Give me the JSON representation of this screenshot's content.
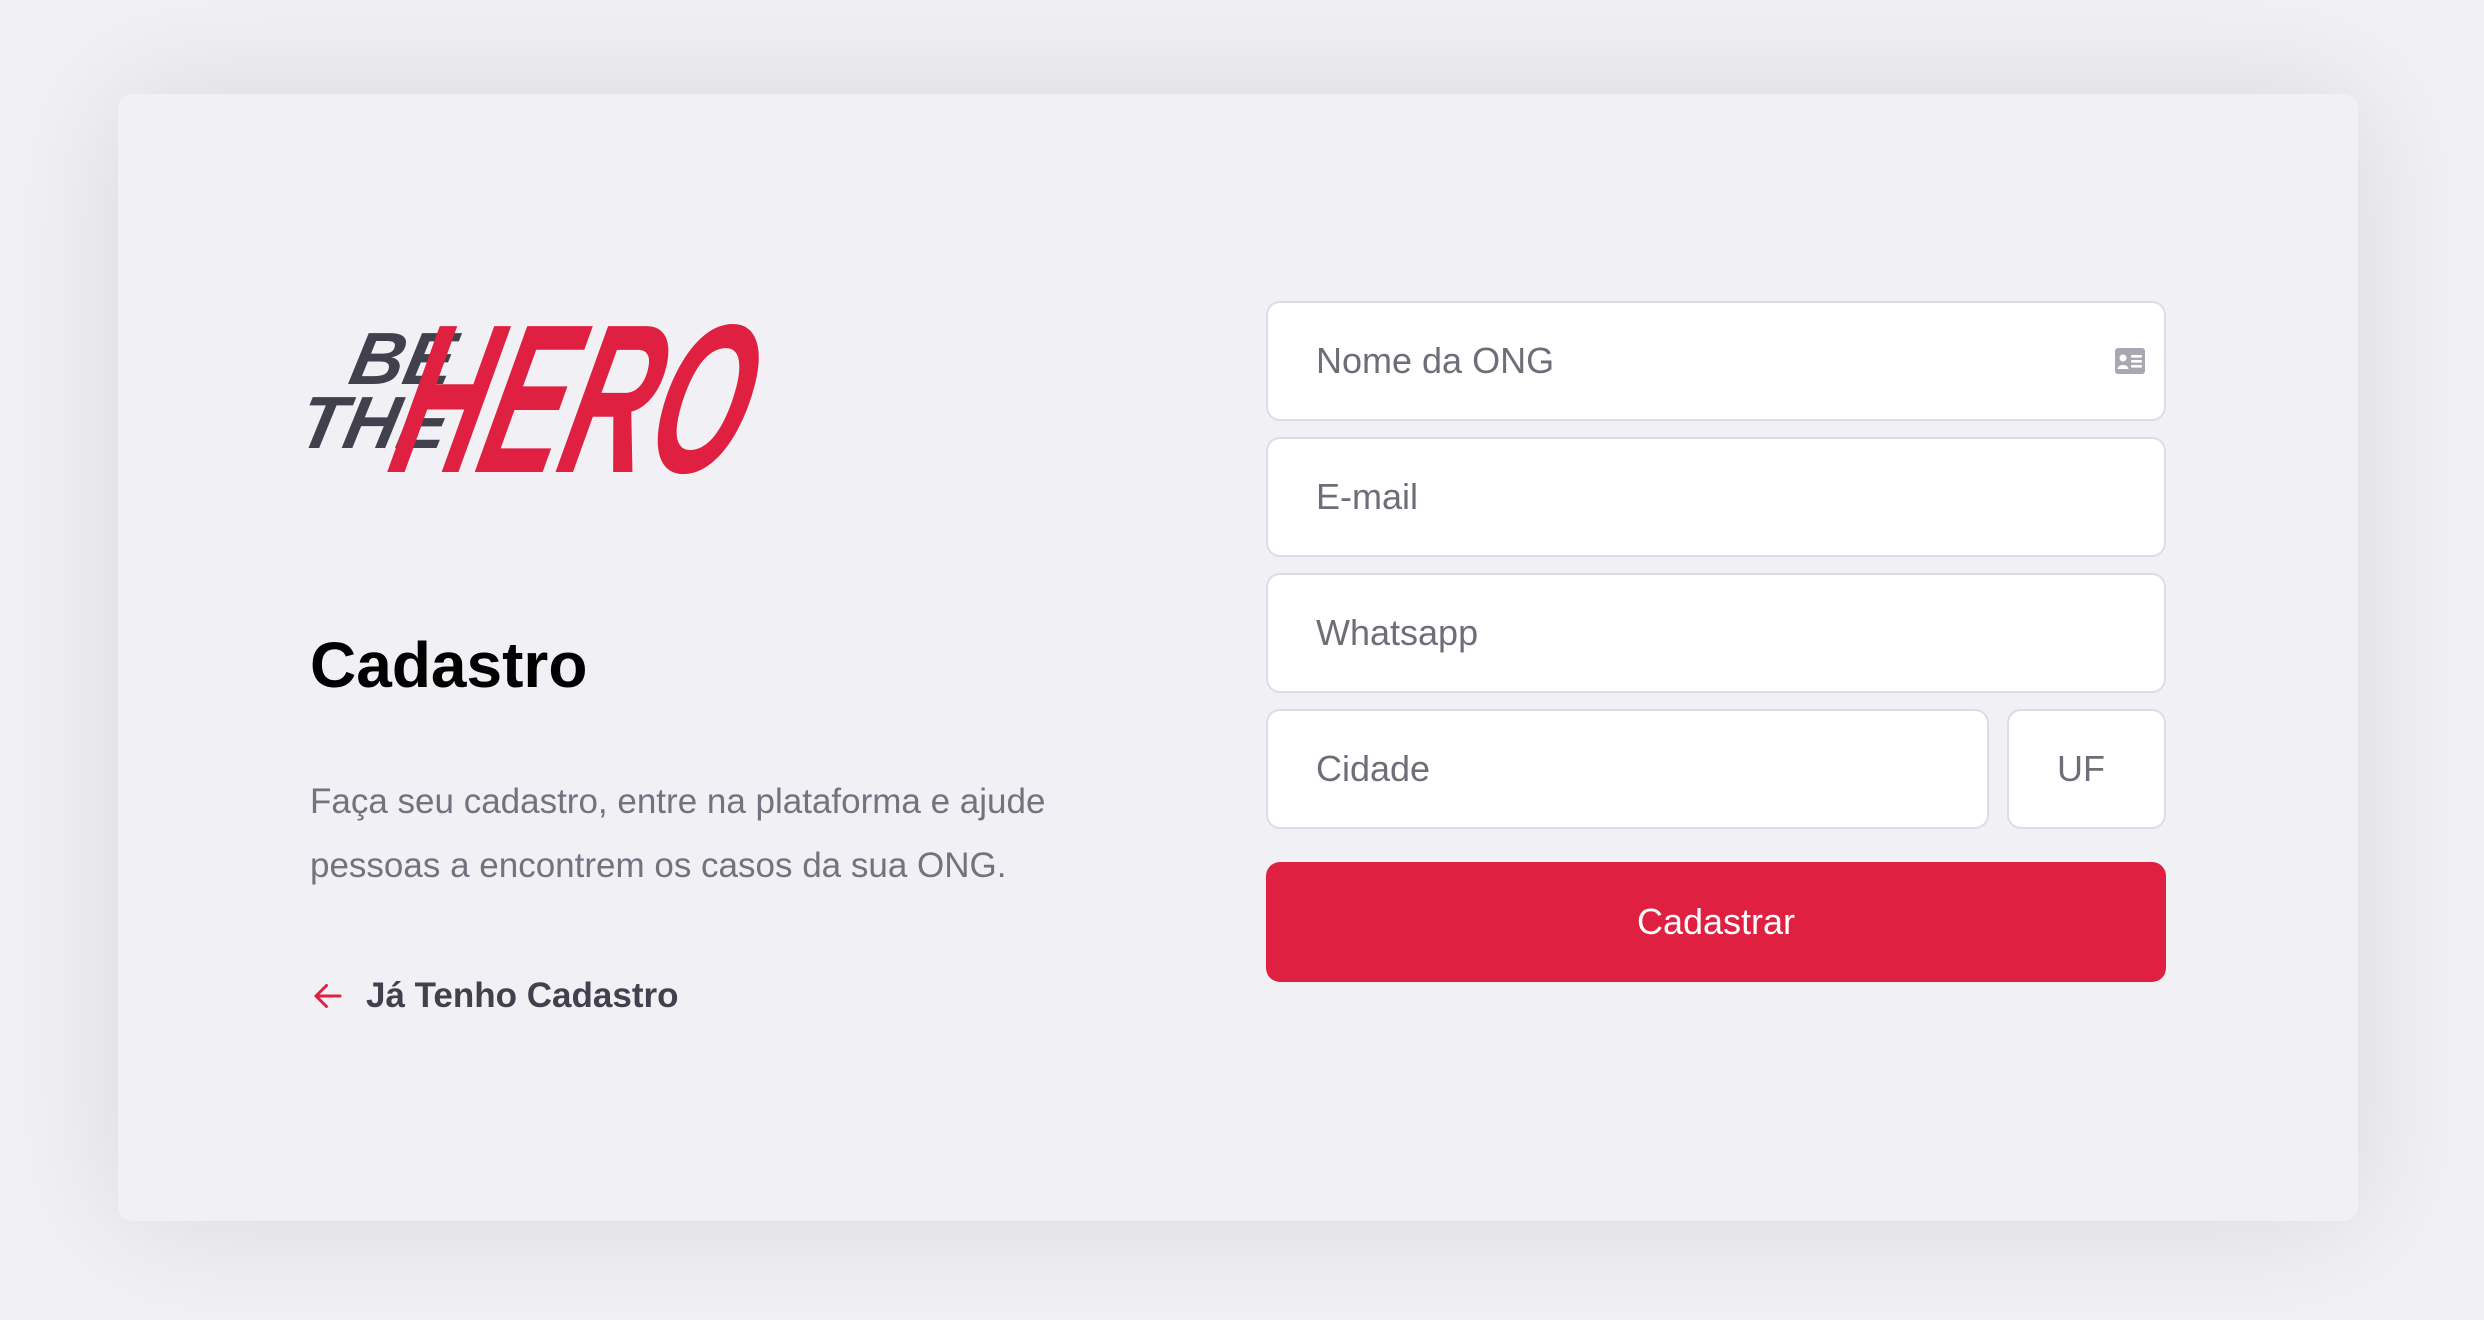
{
  "brand": {
    "logo_text_small_top": "BE",
    "logo_text_small_bottom": "THE",
    "logo_text_large": "HERO",
    "primary_color": "#e02041",
    "secondary_color": "#41414d"
  },
  "page": {
    "title": "Cadastro",
    "description": "Faça seu cadastro, entre na plataforma e ajude pessoas a encontrem os casos da sua ONG.",
    "back_link_label": "Já Tenho Cadastro",
    "back_link_icon": "arrow-left-icon"
  },
  "form": {
    "name_placeholder": "Nome da ONG",
    "name_icon": "id-card-icon",
    "email_placeholder": "E-mail",
    "whatsapp_placeholder": "Whatsapp",
    "city_placeholder": "Cidade",
    "uf_placeholder": "UF",
    "submit_label": "Cadastrar"
  }
}
